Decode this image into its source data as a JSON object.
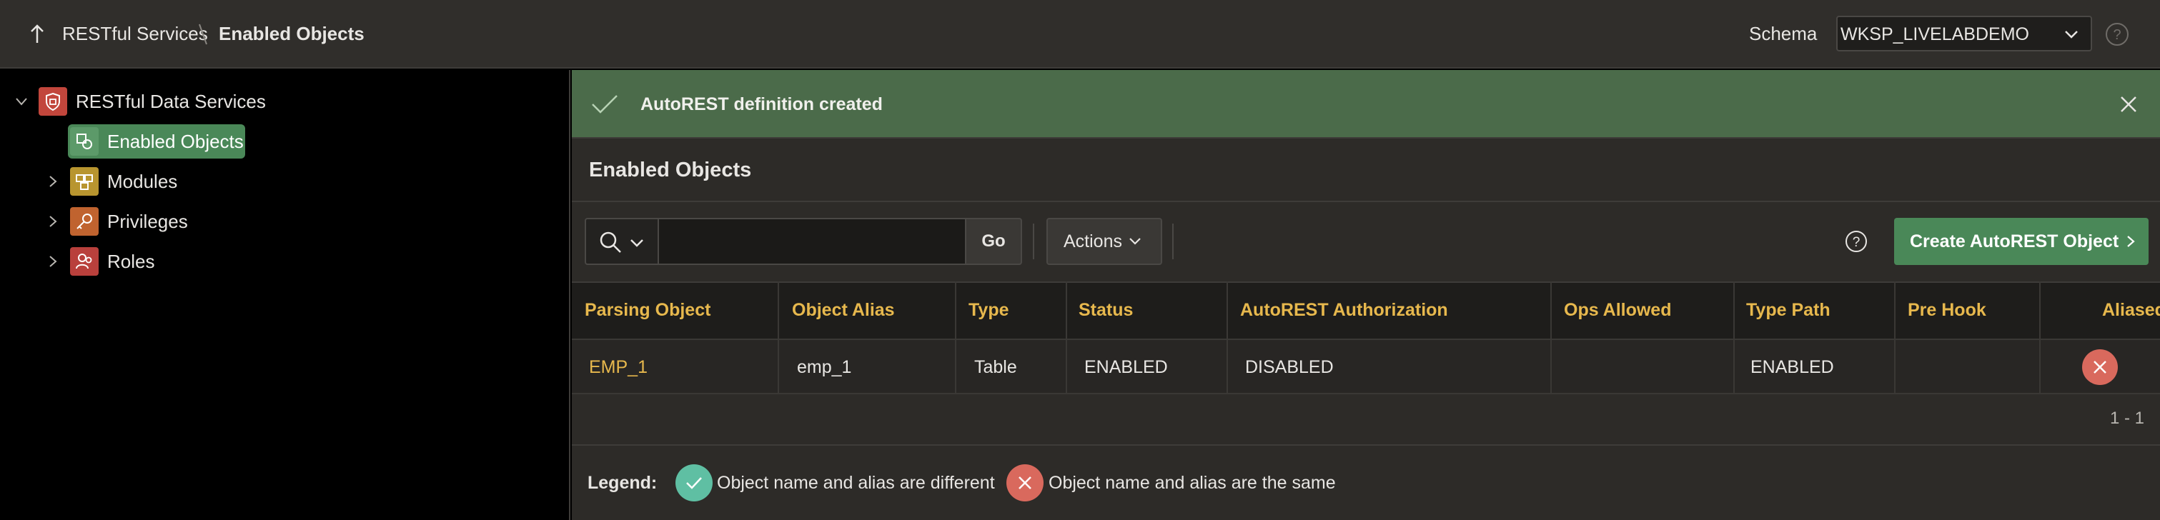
{
  "header": {
    "breadcrumb_parent": "RESTful Services",
    "breadcrumb_current": "Enabled Objects",
    "schema_label": "Schema",
    "schema_value": "WKSP_LIVELABDEMO"
  },
  "tree": {
    "root": "RESTful Data Services",
    "items": [
      {
        "label": "Enabled Objects",
        "selected": true
      },
      {
        "label": "Modules"
      },
      {
        "label": "Privileges"
      },
      {
        "label": "Roles"
      }
    ]
  },
  "alert": {
    "message": "AutoREST definition created"
  },
  "region": {
    "title": "Enabled Objects"
  },
  "toolbar": {
    "search_value": "",
    "go_label": "Go",
    "actions_label": "Actions",
    "create_label": "Create AutoREST Object"
  },
  "table": {
    "headers": [
      "Parsing Object",
      "Object Alias",
      "Type",
      "Status",
      "AutoREST Authorization",
      "Ops Allowed",
      "Type Path",
      "Pre Hook",
      "Aliased"
    ],
    "rows": [
      {
        "parsing_object": "EMP_1",
        "object_alias": "emp_1",
        "type": "Table",
        "status": "ENABLED",
        "authorization": "DISABLED",
        "ops_allowed": "",
        "type_path": "ENABLED",
        "pre_hook": "",
        "aliased": "same"
      }
    ],
    "pagination": "1 - 1"
  },
  "legend": {
    "title": "Legend:",
    "different": "Object name and alias are different",
    "same": "Object name and alias are the same"
  },
  "colors": {
    "accent_green": "#4a8858",
    "alert_bg": "#4b6b4a",
    "link_gold": "#e7b84d",
    "icon_red": "#d9695d",
    "icon_teal": "#5fbfa3"
  }
}
